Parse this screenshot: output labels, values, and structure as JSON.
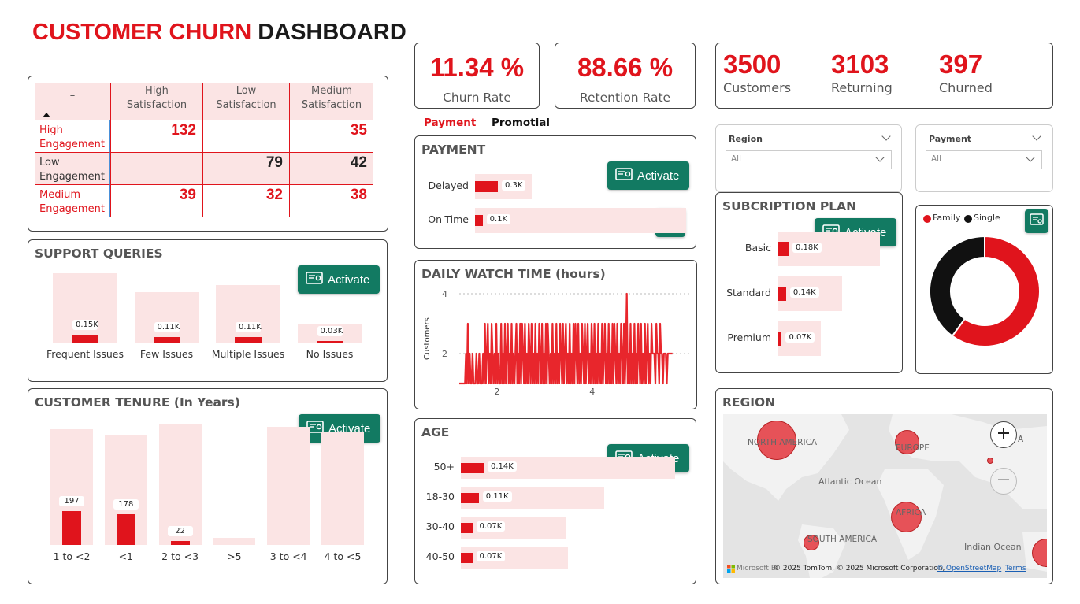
{
  "header": {
    "title_part1": "CUSTOMER CHURN",
    "title_part2": "DASHBOARD"
  },
  "kpis": {
    "churn_rate": {
      "value": "11.34 %",
      "label": "Churn Rate"
    },
    "retention_rate": {
      "value": "88.66 %",
      "label": "Retention Rate"
    },
    "customers": {
      "value": "3500",
      "label": "Customers"
    },
    "returning": {
      "value": "3103",
      "label": "Returning"
    },
    "churned": {
      "value": "397",
      "label": "Churned"
    }
  },
  "activate_label": "Activate",
  "tabs": {
    "payment": "Payment",
    "promotial": "Promotial"
  },
  "slicers": {
    "region": {
      "label": "Region",
      "value": "All"
    },
    "payment": {
      "label": "Payment",
      "value": "All"
    }
  },
  "matrix": {
    "corner": "–",
    "columns": [
      "High\nSatisfaction",
      "Low\nSatisfaction",
      "Medium\nSatisfaction"
    ],
    "rows": [
      {
        "label": "High\nEngagement",
        "values": [
          "132",
          "",
          "35"
        ]
      },
      {
        "label": "Low\nEngagement",
        "values": [
          "",
          "79",
          "42"
        ]
      },
      {
        "label": "Medium\nEngagement",
        "values": [
          "39",
          "32",
          "38"
        ]
      }
    ]
  },
  "region_map": {
    "title": "REGION",
    "labels": {
      "north_america": "NORTH AMERICA",
      "europe": "EUROPE",
      "asia": "A",
      "atlantic": "Atlantic Ocean",
      "africa": "AFRICA",
      "south_america": "SOUTH AMERICA",
      "indian": "Indian Ocean"
    },
    "attribution": "© 2025 TomTom, © 2025 Microsoft Corporation,",
    "osm": "© OpenStreetMap",
    "terms": "Terms",
    "brand": "Microsoft Bi"
  },
  "chart_data": [
    {
      "id": "support",
      "type": "bar",
      "title": "SUPPORT QUERIES",
      "categories": [
        "Frequent Issues",
        "Few Issues",
        "Multiple Issues",
        "No Issues"
      ],
      "values": [
        0.15,
        0.11,
        0.11,
        0.03
      ],
      "labels": [
        "0.15K",
        "0.11K",
        "0.11K",
        "0.03K"
      ],
      "background_values": [
        1.0,
        0.73,
        0.83,
        0.27
      ]
    },
    {
      "id": "tenure",
      "type": "bar",
      "title": "CUSTOMER TENURE (In Years)",
      "categories": [
        "1 to <2",
        "<1",
        "2 to <3",
        ">5",
        "3 to <4",
        "4 to <5"
      ],
      "values": [
        197,
        178,
        22,
        0,
        0,
        0
      ],
      "labels": [
        "197",
        "178",
        "22",
        "",
        "",
        ""
      ],
      "background_values": [
        1.0,
        0.95,
        1.04,
        0.06,
        1.02,
        0.98
      ]
    },
    {
      "id": "payment",
      "type": "bar",
      "orientation": "horizontal",
      "title": "PAYMENT",
      "categories": [
        "Delayed",
        "On-Time"
      ],
      "values": [
        0.3,
        0.1
      ],
      "labels": [
        "0.3K",
        "0.1K"
      ],
      "background_values": [
        0.27,
        1.0
      ]
    },
    {
      "id": "watch",
      "type": "line",
      "title": "DAILY WATCH TIME (hours)",
      "ylabel": "Customers",
      "xticks": [
        "2",
        "4"
      ],
      "yticks": [
        "4",
        "2"
      ],
      "ylim": [
        1,
        4
      ],
      "xlim": [
        1.2,
        5.9
      ],
      "x": [
        1.2,
        1.3,
        1.32,
        1.34,
        1.36,
        1.38,
        1.4,
        1.42,
        1.44,
        1.46,
        1.48,
        1.5,
        1.52,
        1.54,
        1.56,
        1.58,
        1.6,
        1.62,
        1.64,
        1.66,
        1.68,
        1.7,
        1.72,
        1.74,
        1.76,
        1.78,
        1.8,
        1.82,
        1.84,
        1.86,
        1.88,
        1.9,
        1.92,
        1.94,
        1.96,
        1.98,
        2.0,
        2.02,
        2.04,
        2.06,
        2.08,
        2.1,
        2.12,
        2.14,
        2.16,
        2.18,
        2.2,
        2.22,
        2.24,
        2.26,
        2.28,
        2.3,
        2.32,
        2.34,
        2.36,
        2.38,
        2.4,
        2.42,
        2.44,
        2.46,
        2.48,
        2.5,
        2.52,
        2.54,
        2.56,
        2.58,
        2.6,
        2.62,
        2.64,
        2.66,
        2.68,
        2.7,
        2.72,
        2.74,
        2.76,
        2.78,
        2.8,
        2.82,
        2.84,
        2.86,
        2.88,
        2.9,
        2.92,
        2.94,
        2.96,
        2.98,
        3.0,
        3.02,
        3.04,
        3.06,
        3.08,
        3.1,
        3.12,
        3.14,
        3.16,
        3.18,
        3.2,
        3.22,
        3.24,
        3.26,
        3.28,
        3.3,
        3.32,
        3.34,
        3.36,
        3.38,
        3.4,
        3.42,
        3.44,
        3.46,
        3.48,
        3.5,
        3.52,
        3.54,
        3.56,
        3.58,
        3.6,
        3.62,
        3.64,
        3.66,
        3.68,
        3.7,
        3.72,
        3.74,
        3.76,
        3.78,
        3.8,
        3.82,
        3.84,
        3.86,
        3.88,
        3.9,
        3.92,
        3.94,
        3.96,
        3.98,
        4.0,
        4.02,
        4.04,
        4.06,
        4.08,
        4.1,
        4.12,
        4.14,
        4.16,
        4.18,
        4.2,
        4.22,
        4.24,
        4.26,
        4.28,
        4.3,
        4.32,
        4.34,
        4.36,
        4.38,
        4.4,
        4.42,
        4.44,
        4.46,
        4.48,
        4.5,
        4.52,
        4.54,
        4.56,
        4.58,
        4.6,
        4.62,
        4.64,
        4.66,
        4.68,
        4.7,
        4.72,
        4.74,
        4.76,
        4.78,
        4.8,
        4.82,
        4.84,
        4.86,
        4.88,
        4.9,
        4.92,
        4.94,
        4.96,
        4.98,
        5.0,
        5.02,
        5.04,
        5.06,
        5.08,
        5.1,
        5.12,
        5.14,
        5.16,
        5.18,
        5.2,
        5.22,
        5.24,
        5.26,
        5.28,
        5.3,
        5.32,
        5.34,
        5.36,
        5.38,
        5.4,
        5.42,
        5.44,
        5.46,
        5.48,
        5.5,
        5.52,
        5.54,
        5.56,
        5.58,
        5.6,
        5.62,
        5.64,
        5.66,
        5.68,
        5.7,
        5.72,
        5.74,
        5.76,
        5.78,
        5.8,
        5.82,
        5.84,
        5.86,
        5.88,
        5.9
      ],
      "values": [
        1,
        1,
        1,
        2,
        1,
        3,
        1,
        2,
        1,
        1,
        2,
        1,
        1,
        1,
        2,
        1,
        1,
        2,
        1,
        1,
        1,
        2,
        1,
        3,
        1,
        2,
        3,
        1,
        2,
        1,
        3,
        2,
        1,
        2,
        1,
        3,
        1,
        2,
        1,
        1,
        3,
        1,
        2,
        1,
        3,
        1,
        2,
        3,
        1,
        2,
        1,
        3,
        1,
        2,
        1,
        2,
        3,
        1,
        2,
        1,
        3,
        1,
        3,
        2,
        1,
        3,
        1,
        2,
        1,
        3,
        2,
        1,
        3,
        1,
        2,
        1,
        3,
        1,
        2,
        1,
        3,
        2,
        1,
        3,
        1,
        2,
        1,
        3,
        1,
        3,
        2,
        1,
        2,
        1,
        3,
        1,
        2,
        1,
        3,
        1,
        2,
        1,
        3,
        2,
        1,
        3,
        1,
        2,
        3,
        1,
        2,
        1,
        3,
        1,
        2,
        1,
        3,
        1,
        3,
        2,
        1,
        3,
        1,
        2,
        1,
        3,
        2,
        1,
        3,
        1,
        2,
        3,
        1,
        2,
        1,
        3,
        2,
        1,
        3,
        1,
        2,
        1,
        3,
        1,
        2,
        1,
        3,
        1,
        2,
        3,
        1,
        2,
        1,
        3,
        1,
        2,
        1,
        3,
        1,
        3,
        2,
        1,
        3,
        1,
        2,
        1,
        3,
        2,
        1,
        3,
        1,
        2,
        4,
        1,
        2,
        1,
        3,
        1,
        2,
        1,
        3,
        1,
        2,
        1,
        3,
        2,
        1,
        3,
        1,
        2,
        1,
        3,
        1,
        2,
        3,
        1,
        2,
        1,
        3,
        2,
        2,
        2,
        1,
        3,
        2,
        2,
        1,
        3,
        2,
        2,
        1,
        2,
        2,
        2,
        1,
        2,
        2,
        2,
        2,
        2,
        2
      ]
    },
    {
      "id": "age",
      "type": "bar",
      "orientation": "horizontal",
      "title": "AGE",
      "categories": [
        "50+",
        "18-30",
        "30-40",
        "40-50"
      ],
      "values": [
        0.14,
        0.11,
        0.07,
        0.07
      ],
      "labels": [
        "0.14K",
        "0.11K",
        "0.07K",
        "0.07K"
      ],
      "background_values": [
        1.0,
        0.67,
        0.49,
        0.5
      ]
    },
    {
      "id": "subscription",
      "type": "bar",
      "orientation": "horizontal",
      "title": "SUBCRIPTION PLAN",
      "categories": [
        "Basic",
        "Standard",
        "Premium"
      ],
      "values": [
        0.18,
        0.14,
        0.07
      ],
      "labels": [
        "0.18K",
        "0.14K",
        "0.07K"
      ],
      "background_values": [
        1.0,
        0.63,
        0.42
      ]
    },
    {
      "id": "plan_type",
      "type": "pie",
      "donut": true,
      "categories": [
        "Family",
        "Single"
      ],
      "values": [
        60,
        40
      ],
      "colors": [
        "#e0141c",
        "#111111"
      ],
      "legend": "top-left"
    }
  ],
  "colors": {
    "accent": "#e0141c",
    "bar_bg": "#fbe4e4",
    "activate": "#127a62"
  }
}
